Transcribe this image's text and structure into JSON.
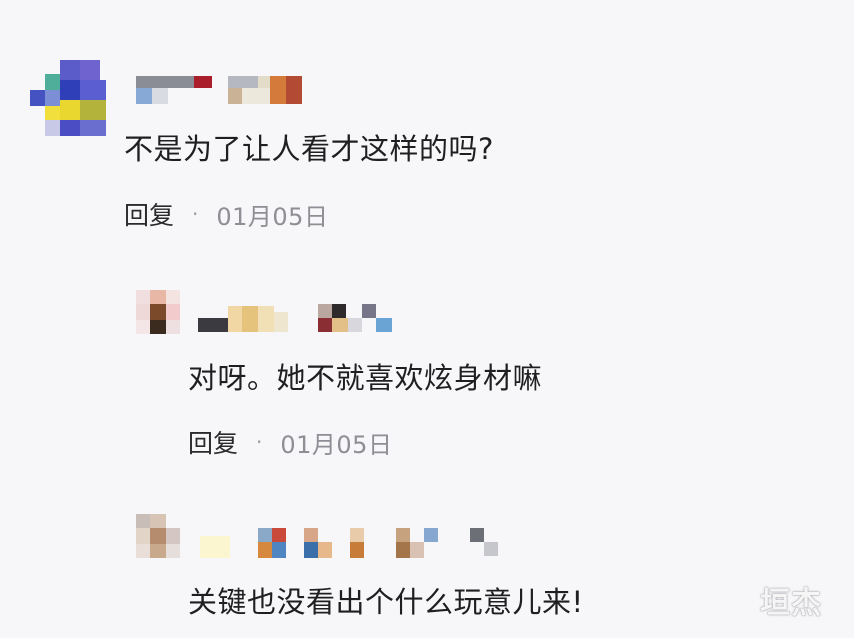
{
  "comments": [
    {
      "text": "不是为了让人看才这样的吗?",
      "reply_label": "回复",
      "separator": "·",
      "date": "01月05日"
    },
    {
      "text": "对呀。她不就喜欢炫身材嘛",
      "reply_label": "回复",
      "separator": "·",
      "date": "01月05日"
    },
    {
      "text": "关键也没看出个什么玩意儿来!"
    }
  ],
  "watermark": "垣杰",
  "colors": {
    "background": "#f7f7f9",
    "text": "#1f1f22",
    "meta": "#8e8e94"
  }
}
